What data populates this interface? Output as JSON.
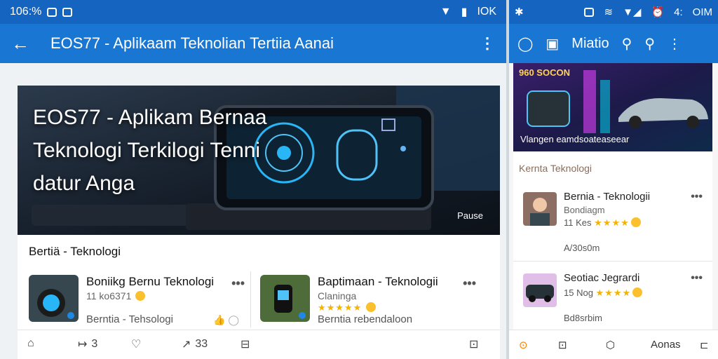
{
  "left": {
    "status": {
      "time": "106:%",
      "battery": "IOK"
    },
    "appbar": {
      "title": "EOS77 - Aplikaam Teknolian Tertiia Aanai",
      "back_icon": "arrow-left-icon",
      "more_icon": "more-vert-icon"
    },
    "hero": {
      "title_line1": "EOS77 - Aplikam Bernaa",
      "title_line2": "Teknologi Terkilogi Tenni",
      "title_line3": "datur Anga",
      "badge": "Pause"
    },
    "section": {
      "title": "Bertiä - Teknologi",
      "cards": [
        {
          "title": "Boniikg Bernu Teknologi",
          "sub": "11 ko6371",
          "meta": "Berntia - Tehsologi"
        },
        {
          "title": "Baptimaan - Teknologii",
          "sub": "Claninga",
          "meta": "Berntia rebendaloon"
        }
      ]
    },
    "bottom": {
      "share_count": "3",
      "forward_count": "33"
    }
  },
  "right": {
    "status": {
      "time": "4:",
      "extra": "OIM"
    },
    "appbar": {
      "title": "Miatio"
    },
    "banner": {
      "logo": "960 SOCON",
      "caption": "Vlangen eamdsoateaseear"
    },
    "section": {
      "title": "Kernta Teknologi",
      "items": [
        {
          "title": "Bernia - Teknologii",
          "sub": "Bondiagm",
          "rating": "11 Kes",
          "meta": "A/30s0m"
        },
        {
          "title": "Seotiac Jegrardi",
          "sub": "",
          "rating": "15 Nog",
          "meta": "Bd8srbim"
        }
      ]
    },
    "bottom": {
      "label": "Aonas"
    }
  },
  "colors": {
    "appbar": "#1976d2",
    "statusbar": "#1565c0",
    "star": "#f5b301"
  }
}
